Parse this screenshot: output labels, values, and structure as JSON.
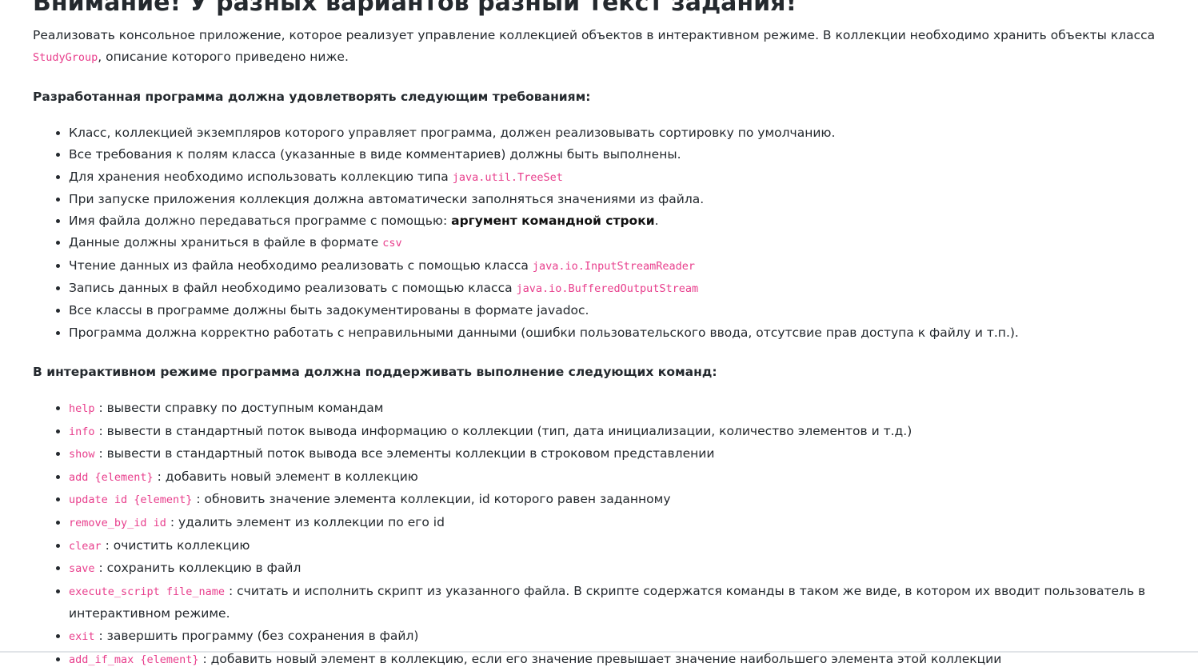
{
  "title": "Внимание! У разных вариантов разный текст задания!",
  "intro": {
    "text_before": "Реализовать консольное приложение, которое реализует управление коллекцией объектов в интерактивном режиме. В коллекции необходимо хранить объекты класса ",
    "code": "StudyGroup",
    "text_after": ", описание которого приведено ниже."
  },
  "requirements": {
    "heading": "Разработанная программа должна удовлетворять следующим требованиям:",
    "items": [
      {
        "text": "Класс, коллекцией экземпляров которого управляет программа, должен реализовывать сортировку по умолчанию."
      },
      {
        "text": "Все требования к полям класса (указанные в виде комментариев) должны быть выполнены."
      },
      {
        "text": "Для хранения необходимо использовать коллекцию типа ",
        "code": "java.util.TreeSet"
      },
      {
        "text": "При запуске приложения коллекция должна автоматически заполняться значениями из файла."
      },
      {
        "text": "Имя файла должно передаваться программе с помощью: ",
        "bold": "аргумент командной строки",
        "after": "."
      },
      {
        "text": "Данные должны храниться в файле в формате ",
        "code": "csv"
      },
      {
        "text": "Чтение данных из файла необходимо реализовать с помощью класса ",
        "code": "java.io.InputStreamReader"
      },
      {
        "text": "Запись данных в файл необходимо реализовать с помощью класса ",
        "code": "java.io.BufferedOutputStream"
      },
      {
        "text": "Все классы в программе должны быть задокументированы в формате javadoc."
      },
      {
        "text": "Программа должна корректно работать с неправильными данными (ошибки пользовательского ввода, отсутсвие прав доступа к файлу и т.п.)."
      }
    ]
  },
  "commands": {
    "heading": "В интерактивном режиме программа должна поддерживать выполнение следующих команд:",
    "items": [
      {
        "code": "help",
        "text": " : вывести справку по доступным командам"
      },
      {
        "code": "info",
        "text": " : вывести в стандартный поток вывода информацию о коллекции (тип, дата инициализации, количество элементов и т.д.)"
      },
      {
        "code": "show",
        "text": " : вывести в стандартный поток вывода все элементы коллекции в строковом представлении"
      },
      {
        "code": "add {element}",
        "text": " : добавить новый элемент в коллекцию"
      },
      {
        "code": "update id {element}",
        "text": " : обновить значение элемента коллекции, id которого равен заданному"
      },
      {
        "code": "remove_by_id id",
        "text": " : удалить элемент из коллекции по его id"
      },
      {
        "code": "clear",
        "text": " : очистить коллекцию"
      },
      {
        "code": "save",
        "text": " : сохранить коллекцию в файл"
      },
      {
        "code": "execute_script file_name",
        "text": " : считать и исполнить скрипт из указанного файла. В скрипте содержатся команды в таком же виде, в котором их вводит пользователь в интерактивном режиме."
      },
      {
        "code": "exit",
        "text": " : завершить программу (без сохранения в файл)"
      },
      {
        "code": "add_if_max {element}",
        "text": " : добавить новый элемент в коллекцию, если его значение превышает значение наибольшего элемента этой коллекции"
      }
    ]
  },
  "colors": {
    "text": "#24292e",
    "code": "#e83e8c",
    "background": "#ffffff"
  }
}
